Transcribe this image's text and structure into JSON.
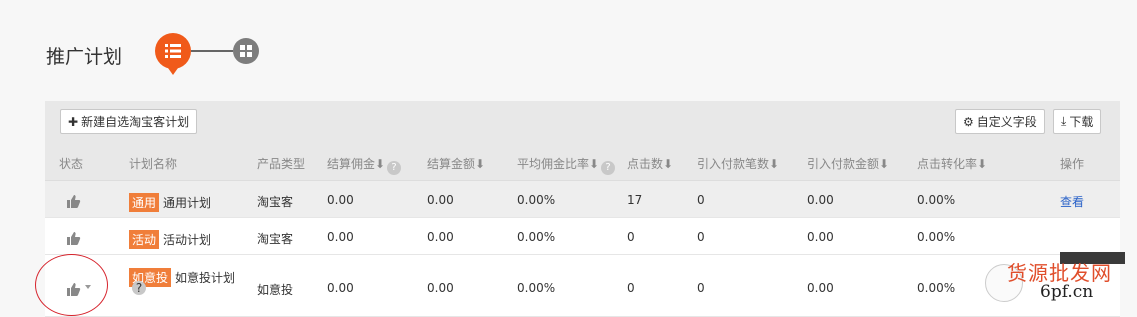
{
  "page": {
    "title": "推广计划"
  },
  "view_switch": {
    "list_icon": "list-icon",
    "grid_icon": "grid-icon"
  },
  "toolbar": {
    "new_label": "新建自选淘宝客计划",
    "custom_label": "自定义字段",
    "download_label": "下载"
  },
  "columns": [
    "状态",
    "计划名称",
    "产品类型",
    "结算佣金",
    "结算金额",
    "平均佣金比率",
    "点击数",
    "引入付款笔数",
    "引入付款金额",
    "点击转化率",
    "操作"
  ],
  "rows": [
    {
      "badge": "通用",
      "name": "通用计划",
      "type": "淘宝客",
      "settle_commission": "0.00",
      "settle_amount": "0.00",
      "avg_rate": "0.00%",
      "clicks": "17",
      "orders": "0",
      "order_amount": "0.00",
      "conversion": "0.00%",
      "action": "查看"
    },
    {
      "badge": "活动",
      "name": "活动计划",
      "type": "淘宝客",
      "settle_commission": "0.00",
      "settle_amount": "0.00",
      "avg_rate": "0.00%",
      "clicks": "0",
      "orders": "0",
      "order_amount": "0.00",
      "conversion": "0.00%",
      "action": ""
    },
    {
      "badge": "如意投",
      "name": "如意投计划",
      "type": "如意投",
      "settle_commission": "0.00",
      "settle_amount": "0.00",
      "avg_rate": "0.00%",
      "clicks": "0",
      "orders": "0",
      "order_amount": "0.00",
      "conversion": "0.00%",
      "action": ""
    }
  ],
  "watermark": {
    "title": "货源批发网",
    "site": "6pf.cn"
  },
  "colors": {
    "accent": "#f05a1a",
    "badge": "#f07e3a",
    "link": "#2a62c8",
    "annotation": "#d6232c"
  }
}
